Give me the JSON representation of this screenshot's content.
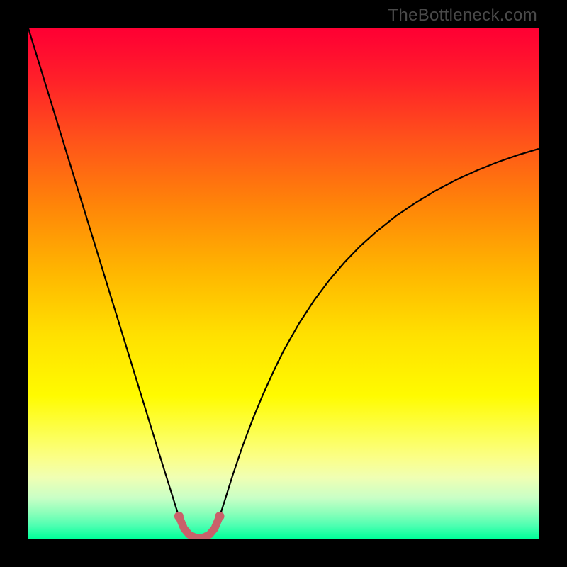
{
  "watermark": "TheBottleneck.com",
  "chart_data": {
    "type": "line",
    "title": "",
    "xlabel": "",
    "ylabel": "",
    "xlim": [
      0,
      100
    ],
    "ylim": [
      0,
      100
    ],
    "annotations": [],
    "background_gradient": {
      "type": "vertical",
      "stops": [
        {
          "pos": 0.0,
          "color": "#ff0033"
        },
        {
          "pos": 0.03,
          "color": "#ff0831"
        },
        {
          "pos": 0.1,
          "color": "#ff2029"
        },
        {
          "pos": 0.22,
          "color": "#ff531a"
        },
        {
          "pos": 0.35,
          "color": "#ff8608"
        },
        {
          "pos": 0.48,
          "color": "#ffb700"
        },
        {
          "pos": 0.6,
          "color": "#ffe000"
        },
        {
          "pos": 0.72,
          "color": "#fffb00"
        },
        {
          "pos": 0.8,
          "color": "#fcff59"
        },
        {
          "pos": 0.84,
          "color": "#fbff86"
        },
        {
          "pos": 0.88,
          "color": "#f0ffb3"
        },
        {
          "pos": 0.92,
          "color": "#c9ffc6"
        },
        {
          "pos": 0.95,
          "color": "#8affba"
        },
        {
          "pos": 0.975,
          "color": "#4cffb1"
        },
        {
          "pos": 1.0,
          "color": "#00ff99"
        }
      ]
    },
    "series": [
      {
        "name": "left-branch",
        "color": "#000000",
        "stroke_width": 2.2,
        "data": [
          {
            "x": 0.0,
            "y": 100.0
          },
          {
            "x": 2.0,
            "y": 93.5
          },
          {
            "x": 4.0,
            "y": 87.0
          },
          {
            "x": 6.0,
            "y": 80.5
          },
          {
            "x": 8.0,
            "y": 74.0
          },
          {
            "x": 10.0,
            "y": 67.5
          },
          {
            "x": 12.0,
            "y": 61.0
          },
          {
            "x": 14.0,
            "y": 54.5
          },
          {
            "x": 16.0,
            "y": 48.0
          },
          {
            "x": 18.0,
            "y": 41.5
          },
          {
            "x": 20.0,
            "y": 35.0
          },
          {
            "x": 22.0,
            "y": 28.5
          },
          {
            "x": 24.0,
            "y": 22.0
          },
          {
            "x": 25.5,
            "y": 17.1
          },
          {
            "x": 27.0,
            "y": 12.3
          },
          {
            "x": 28.0,
            "y": 9.1
          },
          {
            "x": 29.0,
            "y": 5.9
          },
          {
            "x": 29.5,
            "y": 4.4
          },
          {
            "x": 30.5,
            "y": 2.0
          },
          {
            "x": 31.5,
            "y": 0.8
          },
          {
            "x": 32.5,
            "y": 0.3
          },
          {
            "x": 33.5,
            "y": 0.05
          }
        ]
      },
      {
        "name": "right-branch",
        "color": "#000000",
        "stroke_width": 2.2,
        "data": [
          {
            "x": 33.5,
            "y": 0.05
          },
          {
            "x": 34.5,
            "y": 0.3
          },
          {
            "x": 35.5,
            "y": 0.8
          },
          {
            "x": 36.5,
            "y": 2.0
          },
          {
            "x": 37.5,
            "y": 4.4
          },
          {
            "x": 38.5,
            "y": 7.5
          },
          {
            "x": 40.0,
            "y": 12.3
          },
          {
            "x": 42.0,
            "y": 18.2
          },
          {
            "x": 44.0,
            "y": 23.5
          },
          {
            "x": 46.0,
            "y": 28.3
          },
          {
            "x": 48.0,
            "y": 32.7
          },
          {
            "x": 50.0,
            "y": 36.8
          },
          {
            "x": 53.0,
            "y": 42.1
          },
          {
            "x": 56.0,
            "y": 46.7
          },
          {
            "x": 59.0,
            "y": 50.7
          },
          {
            "x": 62.0,
            "y": 54.2
          },
          {
            "x": 65.0,
            "y": 57.3
          },
          {
            "x": 68.0,
            "y": 60.0
          },
          {
            "x": 72.0,
            "y": 63.2
          },
          {
            "x": 76.0,
            "y": 65.9
          },
          {
            "x": 80.0,
            "y": 68.3
          },
          {
            "x": 84.0,
            "y": 70.4
          },
          {
            "x": 88.0,
            "y": 72.2
          },
          {
            "x": 92.0,
            "y": 73.8
          },
          {
            "x": 96.0,
            "y": 75.2
          },
          {
            "x": 100.0,
            "y": 76.4
          }
        ]
      },
      {
        "name": "bottom-red-overlay",
        "color": "#c9606a",
        "stroke_width": 11,
        "linecap": "round",
        "data": [
          {
            "x": 29.5,
            "y": 4.4
          },
          {
            "x": 30.5,
            "y": 2.0
          },
          {
            "x": 31.5,
            "y": 0.8
          },
          {
            "x": 32.5,
            "y": 0.3
          },
          {
            "x": 33.5,
            "y": 0.05
          },
          {
            "x": 34.5,
            "y": 0.3
          },
          {
            "x": 35.5,
            "y": 0.8
          },
          {
            "x": 36.5,
            "y": 2.0
          },
          {
            "x": 37.5,
            "y": 4.4
          }
        ]
      }
    ],
    "markers": [
      {
        "series": "bottom-red-overlay",
        "x": 29.5,
        "y": 4.4,
        "r": 6.5,
        "color": "#c9606a"
      },
      {
        "series": "bottom-red-overlay",
        "x": 37.5,
        "y": 4.4,
        "r": 6.5,
        "color": "#c9606a"
      }
    ]
  }
}
